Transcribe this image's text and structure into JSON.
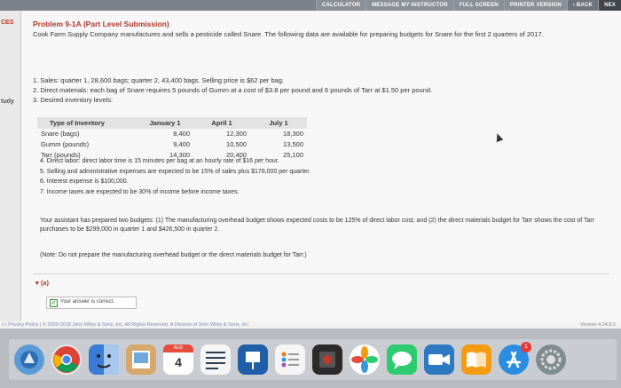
{
  "toolbar": {
    "calculator": "CALCULATOR",
    "message": "MESSAGE MY INSTRUCTOR",
    "fullscreen": "FULL SCREEN",
    "printer": "PRINTER VERSION",
    "back": "‹ BACK",
    "next": "NEX"
  },
  "sidebar": {
    "top_label": "CES",
    "mid_label": "tudy"
  },
  "problem": {
    "title": "Problem 9-1A (Part Level Submission)",
    "intro": "Cook Farm Supply Company manufactures and sells a pesticide called Snare. The following data are available for preparing budgets for Snare for the first 2 quarters of 2017.",
    "items": [
      "1.  Sales: quarter 1, 28,600 bags; quarter 2, 43,400 bags. Selling price is $62 per bag.",
      "2.  Direct materials: each bag of Snare requires 5 pounds of Gumm at a cost of $3.8 per pound and 6 pounds of Tarr at $1.50 per pound.",
      "3.  Desired inventory levels:"
    ]
  },
  "inventory_table": {
    "headers": [
      "Type of Inventory",
      "January 1",
      "April 1",
      "July 1"
    ],
    "rows": [
      [
        "Snare (bags)",
        "8,400",
        "12,300",
        "18,300"
      ],
      [
        "Gumm (pounds)",
        "9,400",
        "10,500",
        "13,500"
      ],
      [
        "Tarr (pounds)",
        "14,300",
        "20,400",
        "25,100"
      ]
    ]
  },
  "more_items": [
    "4.  Direct labor: direct labor time is 15 minutes per bag at an hourly rate of $16 per hour.",
    "5.  Selling and administrative expenses are expected to be 15% of sales plus $178,000 per quarter.",
    "6.  Interest expense is $100,000.",
    "7.  Income taxes are expected to be 30% of income before income taxes."
  ],
  "assistant_para": "Your assistant has prepared two budgets: (1) The manufacturing overhead budget shows expected costs to be 125% of direct labor cost, and (2) the direct materials budget for Tarr shows the cost of Tarr purchases to be $299,000 in quarter 1 and $426,500 in quarter 2.",
  "note": "(Note: Do not prepare the manufacturing overhead budget or the direct materials budget for Tarr.)",
  "part": {
    "label": "▾ (a)",
    "answer": "Your answer is correct."
  },
  "footer": {
    "left": "s  |  Privacy Policy  |  © 2000-2018 John Wiley & Sons, Inc. All Rights Reserved. A Division of John Wiley & Sons, Inc.",
    "version": "Version 4.24.8.2"
  },
  "dock": {
    "calendar_month": "AUG",
    "calendar_day": "4",
    "notification_badge": "1"
  }
}
